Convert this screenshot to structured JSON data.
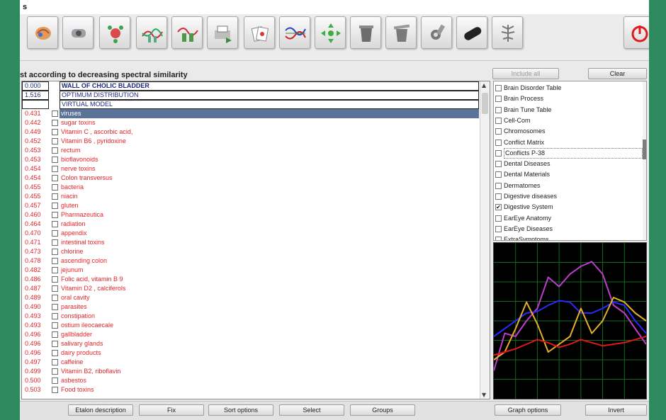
{
  "window": {
    "title": "s"
  },
  "toolbar": {
    "buttons": [
      {
        "name": "brain-scan-icon"
      },
      {
        "name": "hand-sensor-icon"
      },
      {
        "name": "molecule-icon"
      },
      {
        "name": "spectrum-men-icon"
      },
      {
        "name": "spectrum-pair-icon"
      },
      {
        "name": "print-export-icon"
      },
      {
        "name": "cards-icon"
      },
      {
        "name": "waveform-compare-icon"
      },
      {
        "name": "cross-arrows-icon"
      },
      {
        "name": "container-icon"
      },
      {
        "name": "container-open-icon"
      },
      {
        "name": "cog-tools-icon"
      },
      {
        "name": "capsule-icon"
      },
      {
        "name": "nerve-tree-icon"
      },
      {
        "name": "power-icon"
      }
    ],
    "power_color": "#e0191f"
  },
  "main": {
    "heading": "st according to decreasing spectral similarity",
    "rows": [
      {
        "value": "0.000",
        "name": "WALL OF CHOLIC BLADDER",
        "kind": "head bold"
      },
      {
        "value": "1.516",
        "name": "OPTIMUM DISTRIBUTION",
        "kind": "head"
      },
      {
        "value": "",
        "name": "VIRTUAL MODEL",
        "kind": "head"
      },
      {
        "value": "0.431",
        "name": "viruses",
        "kind": "red sel"
      },
      {
        "value": "0.442",
        "name": "sugar toxins",
        "kind": "red"
      },
      {
        "value": "0.449",
        "name": "Vitamin C , ascorbic acid,",
        "kind": "red"
      },
      {
        "value": "0.452",
        "name": "Vitamin B6 , pyridoxine",
        "kind": "red"
      },
      {
        "value": "0.453",
        "name": "rectum",
        "kind": "red"
      },
      {
        "value": "0.453",
        "name": "bioflavonoids",
        "kind": "red"
      },
      {
        "value": "0.454",
        "name": "nerve toxins",
        "kind": "red"
      },
      {
        "value": "0.454",
        "name": "Colon transversus",
        "kind": "red"
      },
      {
        "value": "0.455",
        "name": "bacteria",
        "kind": "red"
      },
      {
        "value": "0.455",
        "name": "niacin",
        "kind": "red"
      },
      {
        "value": "0.457",
        "name": "gluten",
        "kind": "red"
      },
      {
        "value": "0.460",
        "name": "Pharmazeutica",
        "kind": "red"
      },
      {
        "value": "0.464",
        "name": "radiation",
        "kind": "red"
      },
      {
        "value": "0.470",
        "name": "appendix",
        "kind": "red"
      },
      {
        "value": "0.471",
        "name": "intestinal toxins",
        "kind": "red"
      },
      {
        "value": "0.473",
        "name": "chlorine",
        "kind": "red"
      },
      {
        "value": "0.478",
        "name": "ascending colon",
        "kind": "red"
      },
      {
        "value": "0.482",
        "name": "jejunum",
        "kind": "red"
      },
      {
        "value": "0.486",
        "name": "Folic acid, vitamin B 9",
        "kind": "red"
      },
      {
        "value": "0.487",
        "name": "Vitamin D2 , calciferols",
        "kind": "red"
      },
      {
        "value": "0.489",
        "name": "oral cavity",
        "kind": "red"
      },
      {
        "value": "0.490",
        "name": "parasites",
        "kind": "red"
      },
      {
        "value": "0.493",
        "name": "constipation",
        "kind": "red"
      },
      {
        "value": "0.493",
        "name": "ostium ileocaecale",
        "kind": "red"
      },
      {
        "value": "0.496",
        "name": "gallbladder",
        "kind": "red"
      },
      {
        "value": "0.496",
        "name": "salivary glands",
        "kind": "red"
      },
      {
        "value": "0.496",
        "name": "dairy products",
        "kind": "red"
      },
      {
        "value": "0.497",
        "name": "caffeine",
        "kind": "red"
      },
      {
        "value": "0.499",
        "name": "Vitamin B2, riboflavin",
        "kind": "red"
      },
      {
        "value": "0.500",
        "name": "asbestos",
        "kind": "red"
      },
      {
        "value": "0.503",
        "name": "Food toxins",
        "kind": "red"
      }
    ]
  },
  "bottom_buttons": {
    "etalon": "Etalon description",
    "fix": "Fix",
    "sort": "Sort options",
    "select": "Select",
    "groups": "Groups",
    "graph_options": "Graph options",
    "invert": "Invert"
  },
  "right": {
    "include_all": "Include all",
    "clear": "Clear",
    "items": [
      {
        "label": "Brain Disorder Table",
        "checked": false
      },
      {
        "label": "Brain Process",
        "checked": false
      },
      {
        "label": "Brain Tune Table",
        "checked": false
      },
      {
        "label": "Cell-Com",
        "checked": false
      },
      {
        "label": "Chromosomes",
        "checked": false
      },
      {
        "label": "Conflict Matrix",
        "checked": false
      },
      {
        "label": "Conflicts P-38",
        "checked": false,
        "focus": true
      },
      {
        "label": "Dental Diseases",
        "checked": false
      },
      {
        "label": "Dental Materials",
        "checked": false
      },
      {
        "label": "Dermatomes",
        "checked": false
      },
      {
        "label": "Digestive diseases",
        "checked": false
      },
      {
        "label": "Digestive System",
        "checked": true
      },
      {
        "label": "EarEye Anatomy",
        "checked": false
      },
      {
        "label": "EarEye Diseases",
        "checked": false
      },
      {
        "label": "ExtraSymptoms",
        "checked": false
      }
    ]
  },
  "graph": {
    "grid_color": "#0f6a1f",
    "series": [
      {
        "color": "#c03ccf",
        "values": [
          0.18,
          0.42,
          0.4,
          0.5,
          0.58,
          0.78,
          0.72,
          0.8,
          0.85,
          0.88,
          0.8,
          0.6,
          0.55,
          0.45,
          0.35
        ]
      },
      {
        "color": "#2a2aff",
        "values": [
          0.4,
          0.45,
          0.5,
          0.55,
          0.56,
          0.6,
          0.63,
          0.62,
          0.55,
          0.55,
          0.58,
          0.62,
          0.6,
          0.5,
          0.42
        ]
      },
      {
        "color": "#e8b02a",
        "values": [
          0.25,
          0.3,
          0.45,
          0.62,
          0.48,
          0.3,
          0.35,
          0.4,
          0.58,
          0.42,
          0.5,
          0.65,
          0.62,
          0.55,
          0.5
        ]
      },
      {
        "color": "#e11818",
        "values": [
          0.28,
          0.3,
          0.32,
          0.35,
          0.38,
          0.36,
          0.33,
          0.35,
          0.38,
          0.36,
          0.34,
          0.35,
          0.36,
          0.38,
          0.4
        ]
      }
    ]
  }
}
